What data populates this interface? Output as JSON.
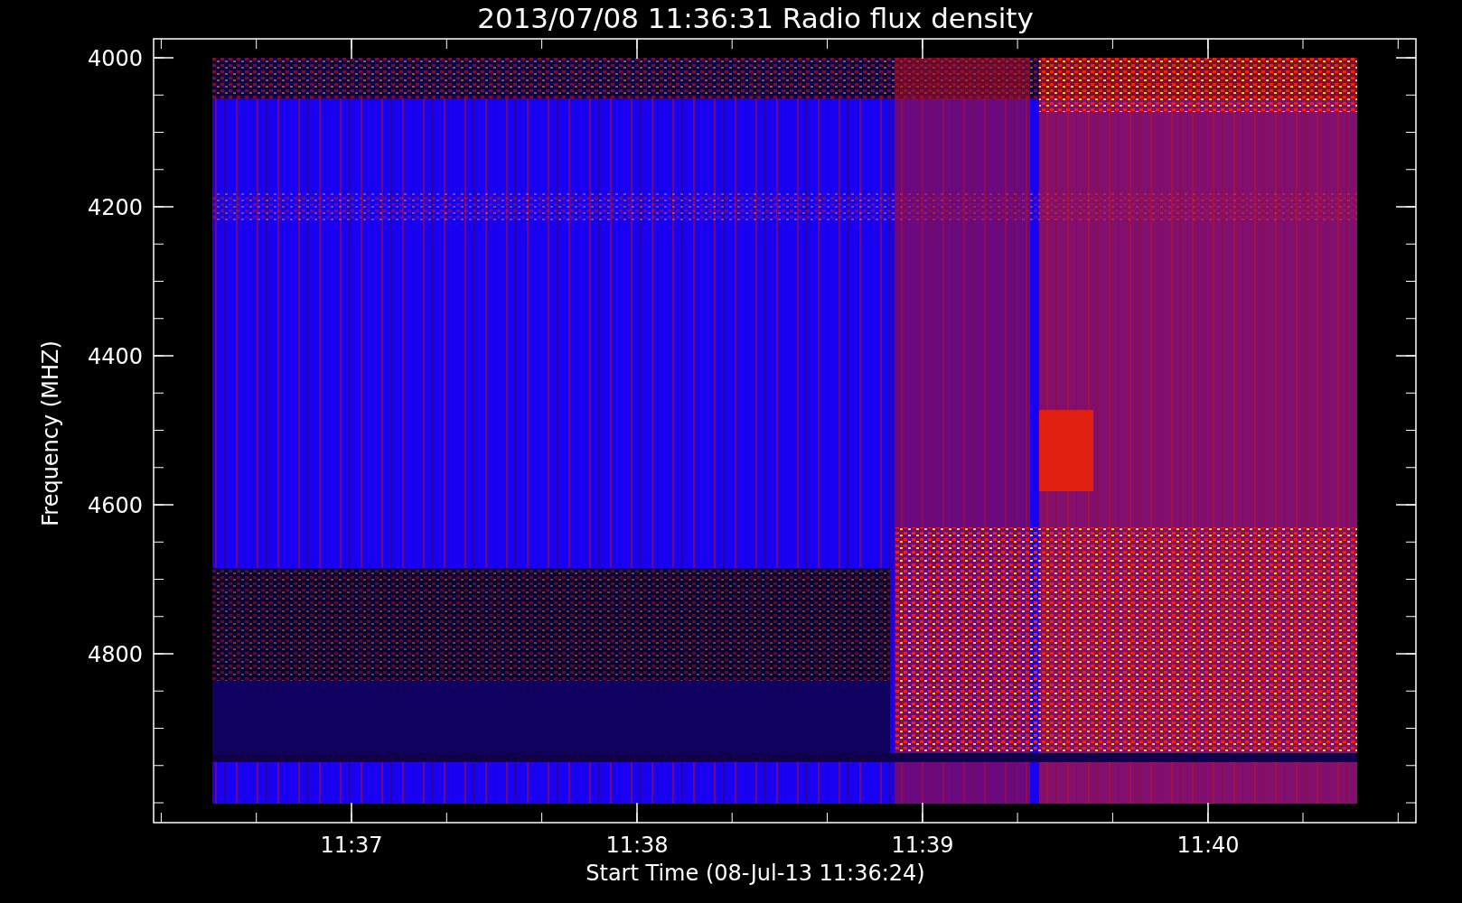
{
  "plot": {
    "title": "2013/07/08 11:36:31 Radio flux density",
    "ylabel": "Frequency (MHZ)",
    "xlabel": "Start Time (08-Jul-13 11:36:24)",
    "yticks": [
      "4000",
      "4200",
      "4400",
      "4600",
      "4800"
    ],
    "xticks": [
      "11:37",
      "11:38",
      "11:39",
      "11:40"
    ]
  }
}
